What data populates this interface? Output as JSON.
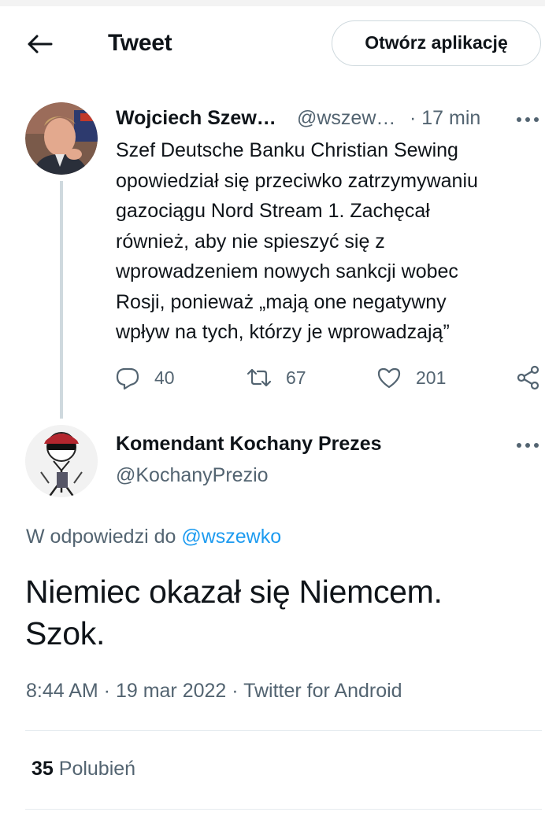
{
  "header": {
    "title": "Tweet",
    "open_app_label": "Otwórz aplikację"
  },
  "original_tweet": {
    "author_name": "Wojciech Szew…",
    "author_handle": "@wszew…",
    "time": "· 17 min",
    "text_lines": [
      "Szef Deutsche Banku Christian Sewing",
      "opowiedział się przeciwko zatrzymywaniu",
      "gazociągu Nord Stream 1.  Zachęcał",
      "również, aby nie spieszyć się z",
      "wprowadzeniem nowych sankcji wobec",
      "Rosji, ponieważ „mają one negatywny",
      "wpływ na tych, którzy je wprowadzają”"
    ],
    "replies": "40",
    "retweets": "67",
    "likes": "201"
  },
  "reply_tweet": {
    "author_name": "Komendant Kochany Prezes",
    "author_handle": "@KochanyPrezio",
    "replying_to_prefix": "W odpowiedzi do ",
    "replying_to_handle": "@wszewko",
    "text_lines": [
      "Niemiec okazał się Niemcem.",
      "Szok."
    ],
    "time": "8:44 AM",
    "date": "19 mar 2022",
    "source": "Twitter for Android",
    "meta_separator": " · ",
    "likes_count": "35",
    "likes_label": "Polubień"
  },
  "colors": {
    "link": "#1d9bf0",
    "muted": "#536471",
    "text": "#0f1419",
    "divider": "#e6ecf0"
  }
}
